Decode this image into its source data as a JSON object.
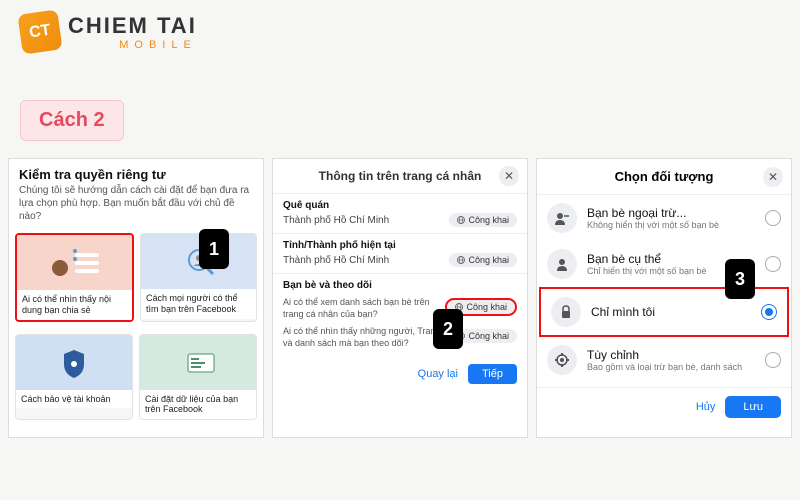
{
  "logo": {
    "icon_text": "CT",
    "title": "CHIEM TAI",
    "sub": "MOBILE"
  },
  "step_badge": "Cách 2",
  "badges": {
    "n1": "1",
    "n2": "2",
    "n3": "3"
  },
  "panel1": {
    "title": "Kiểm tra quyền riêng tư",
    "desc": "Chúng tôi sẽ hướng dẫn cách cài đặt để bạn đưa ra lựa chọn phù hợp. Bạn muốn bắt đầu với chủ đề nào?",
    "card_a": "Ai có thể nhìn thấy nội dung bạn chia sẻ",
    "card_b": "Cách mọi người có thể tìm bạn trên Facebook",
    "card_c": "Cách bảo vệ tài khoản",
    "card_d": "Cài đặt dữ liệu của bạn trên Facebook"
  },
  "panel2": {
    "header": "Thông tin trên trang cá nhân",
    "hometown_lbl": "Quê quán",
    "hometown_val": "Thành phố Hồ Chí Minh",
    "city_lbl": "Tỉnh/Thành phố hiện tại",
    "city_val": "Thành phố Hồ Chí Minh",
    "follow_lbl": "Bạn bè và theo dõi",
    "follow_q1": "Ai có thể xem danh sách bạn bè trên trang cá nhân của bạn?",
    "follow_q2": "Ai có thể nhìn thấy những người, Trang và danh sách mà bạn theo dõi?",
    "public": "Công khai",
    "back": "Quay lại",
    "next": "Tiếp"
  },
  "panel3": {
    "header": "Chọn đối tượng",
    "opt1_t": "Bạn bè ngoại trừ...",
    "opt1_s": "Không hiển thị với một số bạn bè",
    "opt2_t": "Bạn bè cụ thể",
    "opt2_s": "Chỉ hiển thị với một số bạn bè",
    "opt3_t": "Chỉ mình tôi",
    "opt4_t": "Tùy chỉnh",
    "opt4_s": "Bao gồm và loại trừ bạn bè, danh sách",
    "cancel": "Hủy",
    "save": "Lưu"
  }
}
